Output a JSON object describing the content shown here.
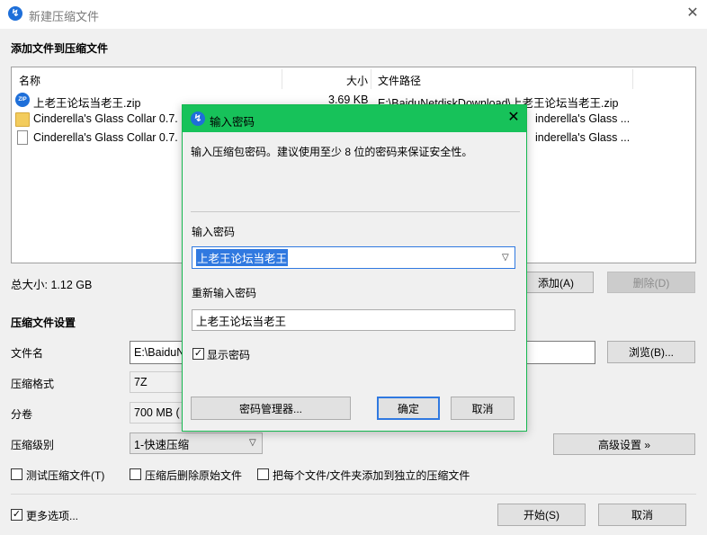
{
  "window": {
    "title": "新建压缩文件"
  },
  "add_section": {
    "title": "添加文件到压缩文件"
  },
  "file_list": {
    "columns": {
      "name": "名称",
      "size": "大小",
      "path": "文件路径"
    },
    "rows": [
      {
        "icon": "zip-file-icon",
        "name": "上老王论坛当老王.zip",
        "size": "3.69 KB",
        "path": "E:\\BaiduNetdiskDownload\\上老王论坛当老王.zip"
      },
      {
        "icon": "folder-icon",
        "name": "Cinderella's Glass Collar 0.7.",
        "size": "",
        "path": "inderella's Glass ..."
      },
      {
        "icon": "file-icon",
        "name": "Cinderella's Glass Collar 0.7.",
        "size": "",
        "path": "inderella's Glass ..."
      }
    ]
  },
  "total_size": "总大小: 1.12 GB",
  "buttons": {
    "add": "添加(A)",
    "delete": "删除(D)",
    "browse": "浏览(B)...",
    "advanced": "高级设置 »",
    "start": "开始(S)",
    "cancel": "取消"
  },
  "settings": {
    "title": "压缩文件设置",
    "filename_label": "文件名",
    "filename_value": "E:\\BaiduN",
    "format_label": "压缩格式",
    "format_value": "7Z",
    "volume_label": "分卷",
    "volume_value": "700 MB (",
    "level_label": "压缩级别",
    "level_value": "1-快速压缩"
  },
  "options": {
    "test": "测试压缩文件(T)",
    "delete_after": "压缩后删除原始文件",
    "separate": "把每个文件/文件夹添加到独立的压缩文件",
    "more": "更多选项..."
  },
  "dialog": {
    "title": "输入密码",
    "hint": "输入压缩包密码。建议使用至少 8 位的密码来保证安全性。",
    "password_label": "输入密码",
    "password_value": "上老王论坛当老王",
    "repeat_label": "重新输入密码",
    "repeat_value": "上老王论坛当老王",
    "show_password": "显示密码",
    "manager_button": "密码管理器...",
    "ok_button": "确定",
    "cancel_button": "取消"
  },
  "colors": {
    "dialog_titlebar": "#17c25a",
    "selection": "#3079e0",
    "app_icon": "#1e6fd9"
  }
}
